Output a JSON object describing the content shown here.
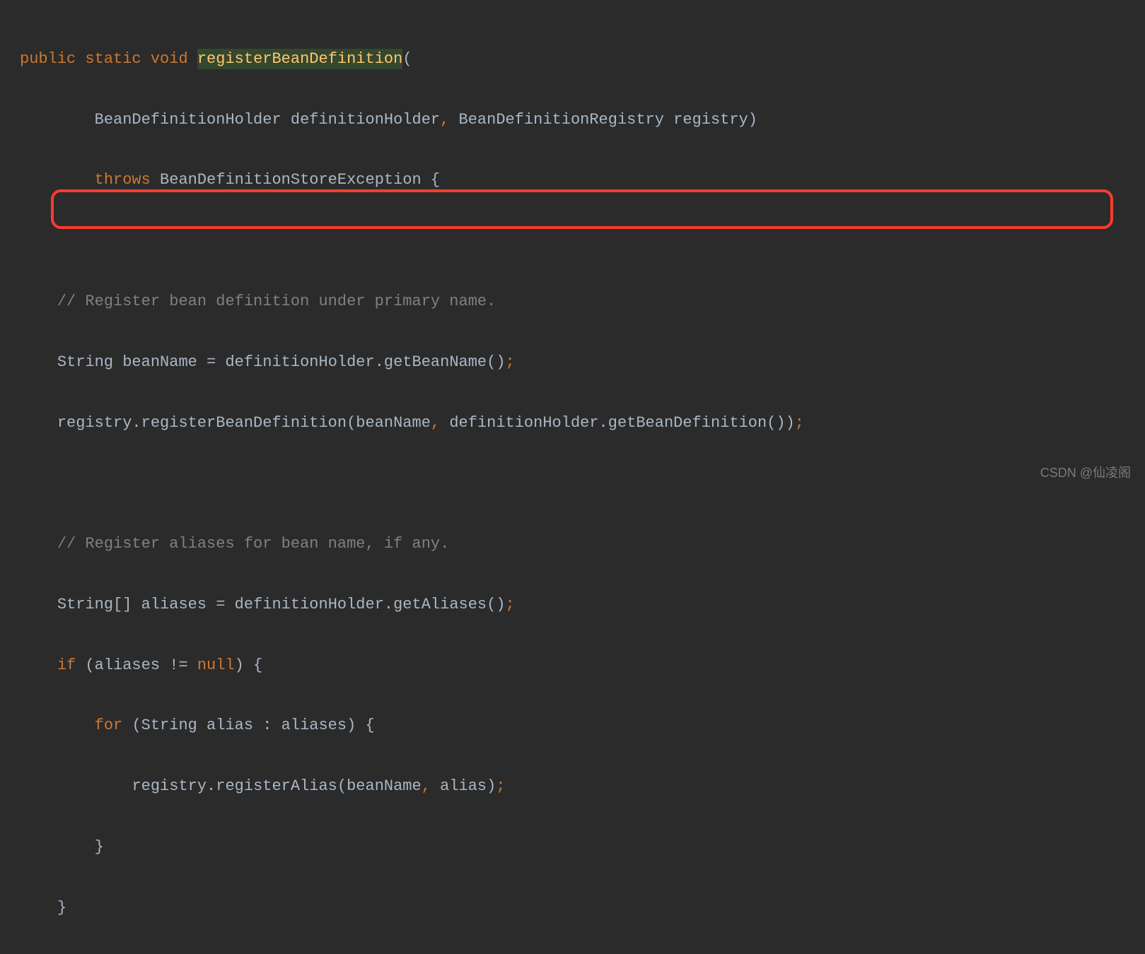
{
  "code": {
    "line1": {
      "public": "public",
      "static": "static",
      "void": "void",
      "method": "registerBeanDefinition",
      "paren": "("
    },
    "line2": {
      "indent": "        ",
      "type1": "BeanDefinitionHolder",
      "param1": "definitionHolder",
      "comma": ",",
      "type2": "BeanDefinitionRegistry",
      "param2": "registry",
      "paren": ")"
    },
    "line3": {
      "indent": "        ",
      "throws": "throws",
      "exception": "BeanDefinitionStoreException",
      "brace": "{"
    },
    "line5": {
      "indent": "    ",
      "comment": "// Register bean definition under primary name."
    },
    "line6": {
      "indent": "    ",
      "type": "String",
      "var": "beanName",
      "eq": "=",
      "expr": "definitionHolder.getBeanName()",
      "semi": ";"
    },
    "line7": {
      "indent": "    ",
      "expr": "registry.registerBeanDefinition(beanName",
      "comma": ",",
      "expr2": "definitionHolder.getBeanDefinition())",
      "semi": ";"
    },
    "line9": {
      "indent": "    ",
      "comment": "// Register aliases for bean name, if any."
    },
    "line10": {
      "indent": "    ",
      "type": "String[]",
      "var": "aliases",
      "eq": "=",
      "expr": "definitionHolder.getAliases()",
      "semi": ";"
    },
    "line11": {
      "indent": "    ",
      "if": "if",
      "cond": "(aliases !=",
      "null": "null",
      "end": ") {"
    },
    "line12": {
      "indent": "        ",
      "for": "for",
      "cond": "(String alias : aliases) {"
    },
    "line13": {
      "indent": "            ",
      "expr": "registry.registerAlias(beanName",
      "comma": ",",
      "expr2": "alias)",
      "semi": ";"
    },
    "line14": {
      "indent": "        ",
      "brace": "}"
    },
    "line15": {
      "indent": "    ",
      "brace": "}"
    }
  },
  "watermark": "CSDN @仙凌阁"
}
